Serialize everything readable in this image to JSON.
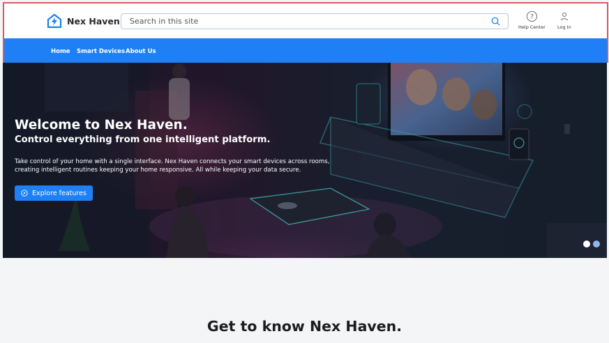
{
  "header": {
    "brand": "Nex Haven",
    "search_placeholder": "Search in this site",
    "help_label": "Help Center",
    "login_label": "Log In"
  },
  "nav": {
    "items": [
      {
        "label": "Home"
      },
      {
        "label": "Smart Devices"
      },
      {
        "label": "About Us"
      }
    ]
  },
  "hero": {
    "title": "Welcome to Nex Haven.",
    "subtitle": "Control everything from one intelligent platform.",
    "body_line1": "Take control of your home with a single interface. Nex Haven connects your smart devices across rooms,",
    "body_line2": "creating intelligent routines keeping your home responsive. All while keeping your data secure.",
    "cta_label": "Explore features",
    "carousel": {
      "slides": 2,
      "active": 1
    }
  },
  "section": {
    "title": "Get to know Nex Haven."
  },
  "colors": {
    "accent": "#1f7ff4",
    "highlight_border": "#e0575b",
    "neon": "#4fd1d1"
  },
  "icons": [
    "logo-icon",
    "search-icon",
    "help-icon",
    "user-icon",
    "compass-icon"
  ]
}
